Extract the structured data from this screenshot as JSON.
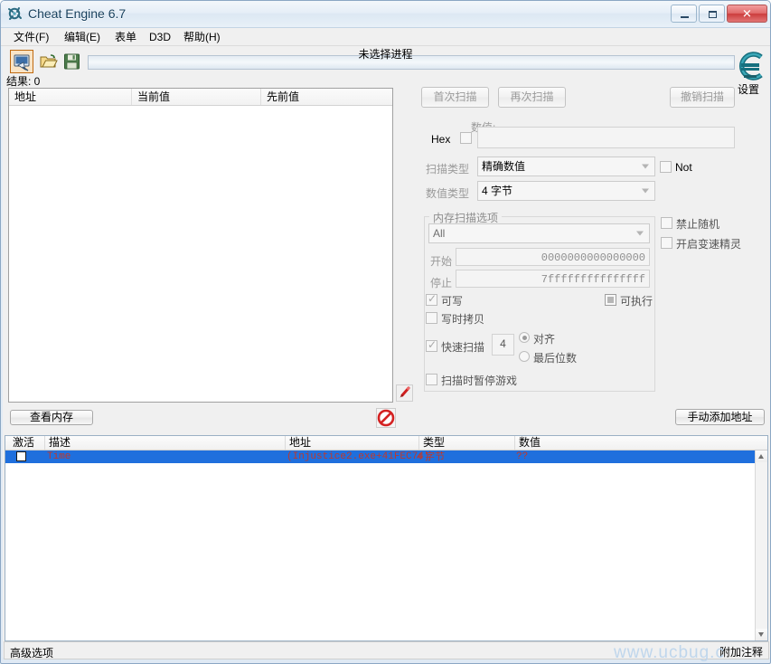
{
  "window": {
    "title": "Cheat Engine 6.7",
    "controls": {
      "minimize": "–",
      "maximize": "□",
      "close": "✕"
    }
  },
  "menu": [
    {
      "label": "文件(F)"
    },
    {
      "label": "编辑(E)"
    },
    {
      "label": "表单"
    },
    {
      "label": "D3D"
    },
    {
      "label": "帮助(H)"
    }
  ],
  "toolbar": {
    "process_icon": "process-select-icon",
    "open_icon": "open-folder-icon",
    "save_icon": "save-disk-icon",
    "process_status": "未选择进程"
  },
  "results": {
    "label": "结果: 0",
    "columns": [
      "地址",
      "当前值",
      "先前值"
    ],
    "rows": []
  },
  "found_footer": {
    "view_memory": "查看内存",
    "manual_add": "手动添加地址",
    "pointer_icon": "red-arrow-icon",
    "stop_icon": "no-entry-icon"
  },
  "scan": {
    "first_scan": "首次扫描",
    "next_scan": "再次扫描",
    "undo_scan": "撤销扫描",
    "hex_label": "Hex",
    "hex_checked": false,
    "value_label": "数值:",
    "value_input": "",
    "scan_type_label": "扫描类型",
    "scan_type_value": "精确数值",
    "not_label": "Not",
    "not_checked": false,
    "value_type_label": "数值类型",
    "value_type_value": "4 字节"
  },
  "memory_scan_options": {
    "group_title": "内存扫描选项",
    "region_value": "All",
    "start_label": "开始",
    "start_value": "0000000000000000",
    "stop_label": "停止",
    "stop_value": "7fffffffffffffff",
    "writable_label": "可写",
    "writable_checked": true,
    "executable_label": "可执行",
    "executable_state": "grey",
    "copy_on_write_label": "写时拷贝",
    "copy_on_write_checked": false,
    "fast_scan_label": "快速扫描",
    "fast_scan_checked": true,
    "fast_scan_value": "4",
    "alignment_label": "对齐",
    "alignment_selected": true,
    "last_digits_label": "最后位数",
    "last_digits_selected": false,
    "pause_game_label": "扫描时暂停游戏",
    "pause_game_checked": false
  },
  "side_options": {
    "no_random_label": "禁止随机",
    "no_random_checked": false,
    "speedhack_label": "开启变速精灵",
    "speedhack_checked": false
  },
  "settings": {
    "logo": "cheat-engine-logo",
    "label": "设置"
  },
  "cheat_table": {
    "columns": [
      "激活",
      "描述",
      "地址",
      "类型",
      "数值"
    ],
    "rows": [
      {
        "active": false,
        "description": "Time",
        "address": "(Injustice2.exe+41FEC74)",
        "type": "4 字节",
        "value": "??"
      }
    ]
  },
  "statusbar": {
    "advanced_options": "高级选项",
    "add_note": "附加注释"
  },
  "watermark": "www.ucbug.c",
  "colors": {
    "selection_blue": "#1f6fdd",
    "table_text_red": "#c0392b",
    "toolbar_selected": "#c06a10",
    "close_button": "#cc3d3d"
  }
}
